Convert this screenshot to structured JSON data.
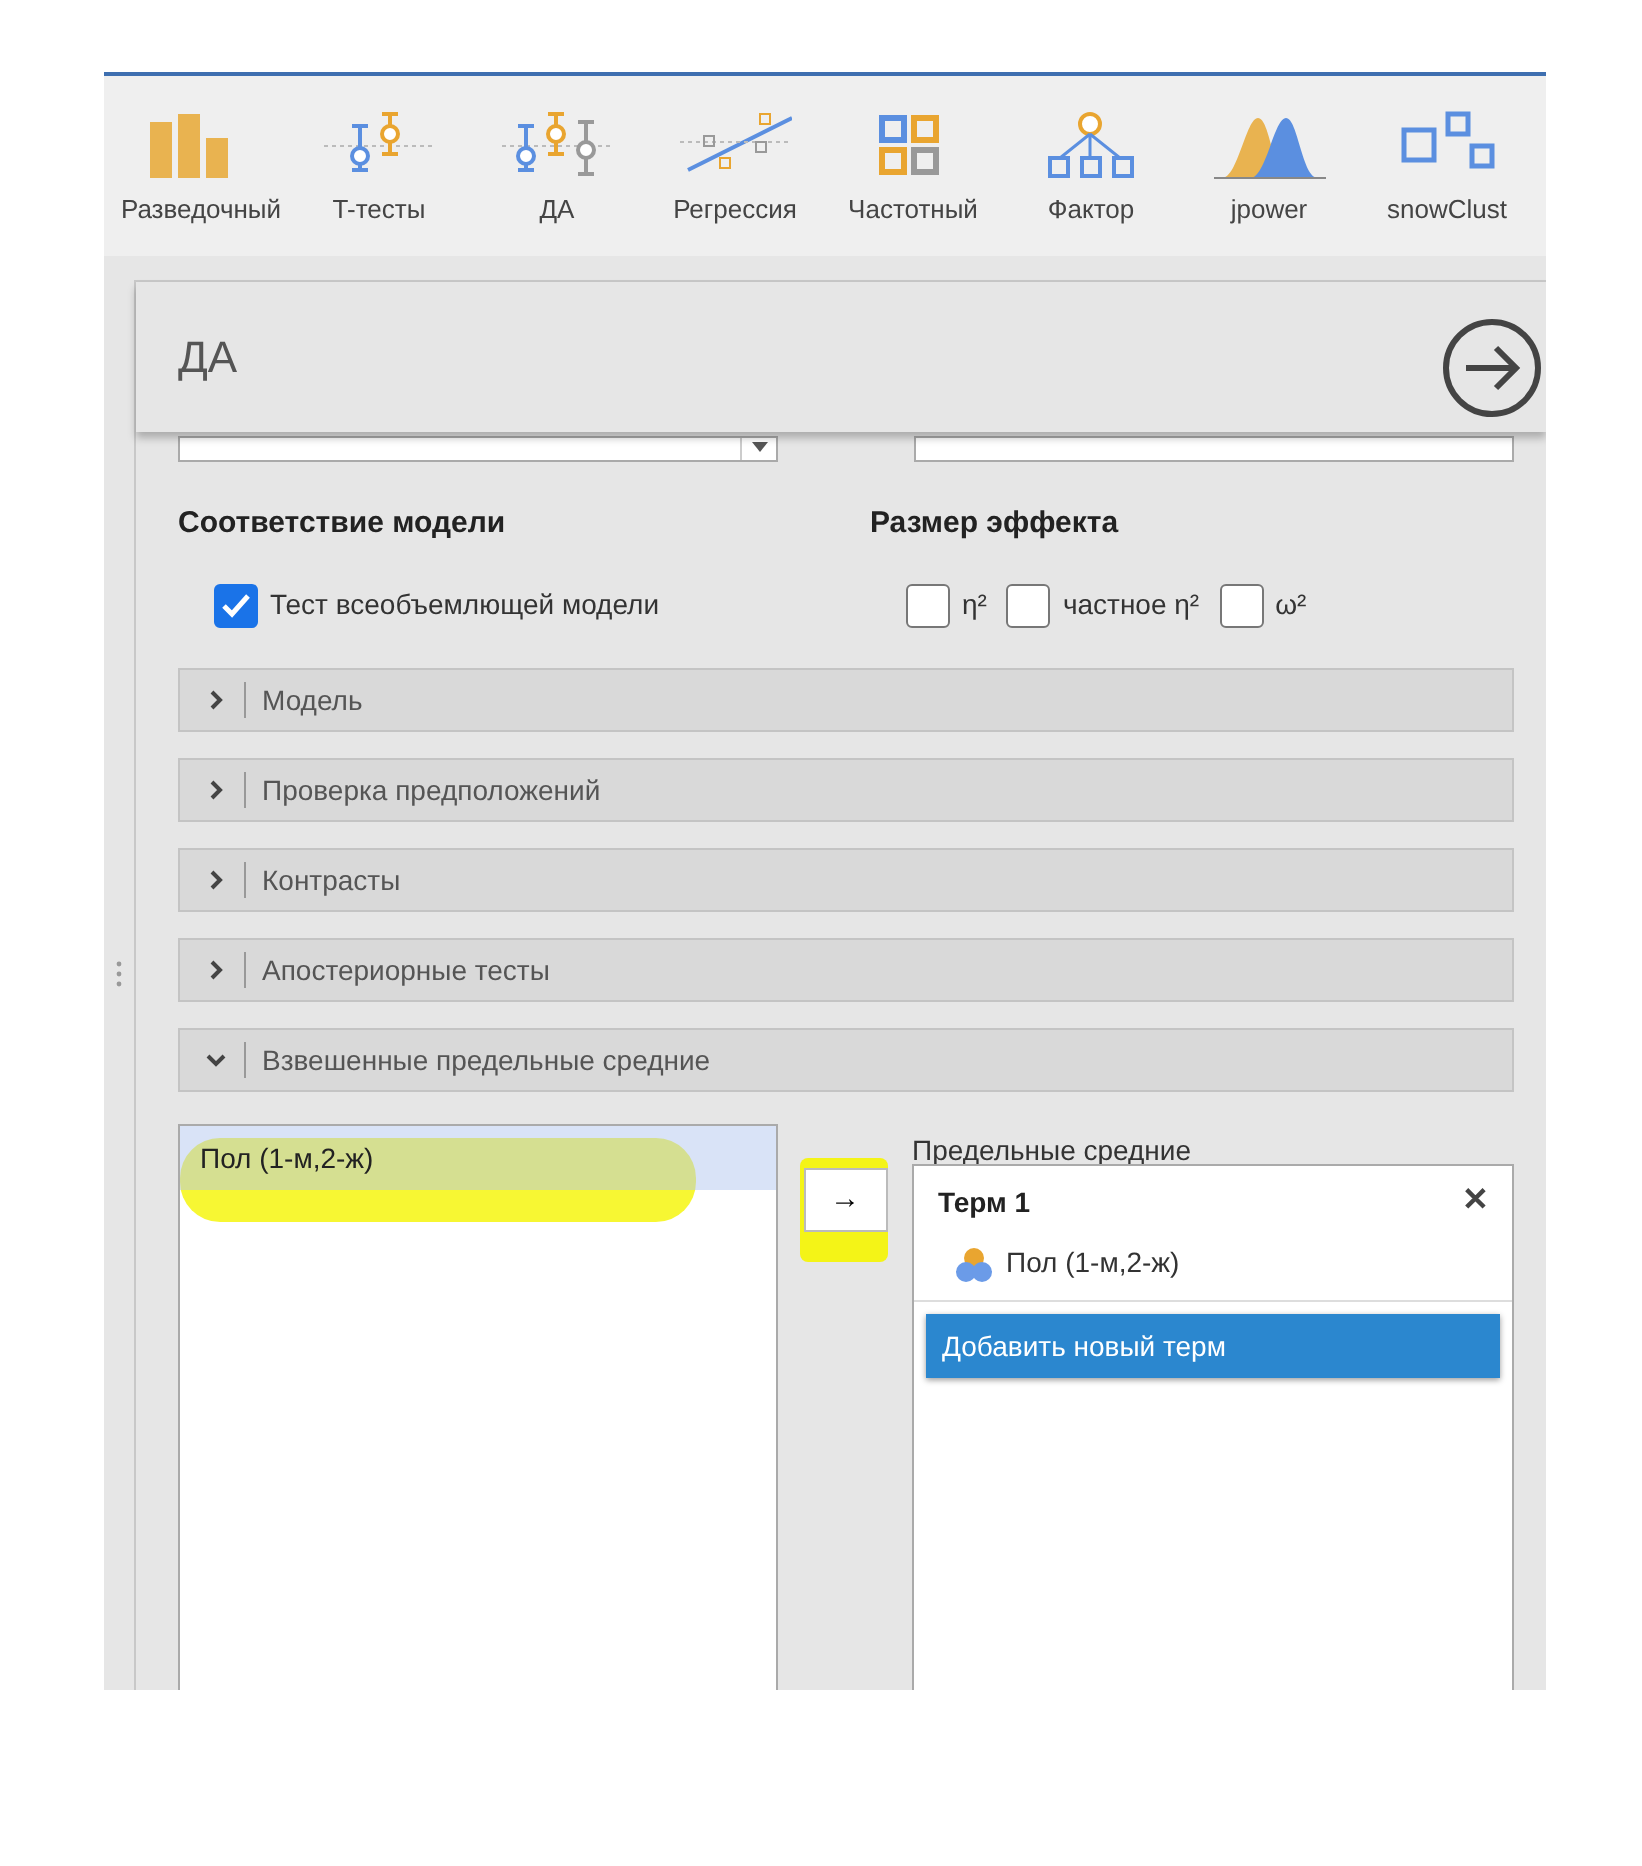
{
  "ribbon": {
    "items": [
      {
        "label": "Разведочный",
        "kind": "bars"
      },
      {
        "label": "T-тесты",
        "kind": "ttest"
      },
      {
        "label": "ДА",
        "kind": "anova"
      },
      {
        "label": "Регрессия",
        "kind": "regression"
      },
      {
        "label": "Частотный",
        "kind": "frequency"
      },
      {
        "label": "Фактор",
        "kind": "factor"
      },
      {
        "label": "jpower",
        "kind": "power"
      },
      {
        "label": "snowClust",
        "kind": "cluster"
      }
    ]
  },
  "panel": {
    "title": "ДА"
  },
  "model_fit": {
    "title": "Соответствие модели",
    "options": [
      {
        "label": "Тест всеобъемлющей модели",
        "checked": true
      }
    ]
  },
  "effect_size": {
    "title": "Размер эффекта",
    "options": [
      {
        "label": "η²",
        "checked": false
      },
      {
        "label": "частное η²",
        "checked": false
      },
      {
        "label": "ω²",
        "checked": false
      }
    ]
  },
  "sections": [
    {
      "label": "Модель",
      "expanded": false
    },
    {
      "label": "Проверка предположений",
      "expanded": false
    },
    {
      "label": "Контрасты",
      "expanded": false
    },
    {
      "label": "Апостериорные тесты",
      "expanded": false
    },
    {
      "label": "Взвешенные предельные средние",
      "expanded": true
    }
  ],
  "variables": [
    {
      "label": "Пол (1-м,2-ж)",
      "selected": true
    }
  ],
  "move_button": {
    "label": "→"
  },
  "marginal_means": {
    "label": "Предельные средние",
    "terms": [
      {
        "title": "Терм 1",
        "close": "✕",
        "items": [
          "Пол (1-м,2-ж)"
        ]
      }
    ],
    "add_button": "Добавить новый терм"
  }
}
